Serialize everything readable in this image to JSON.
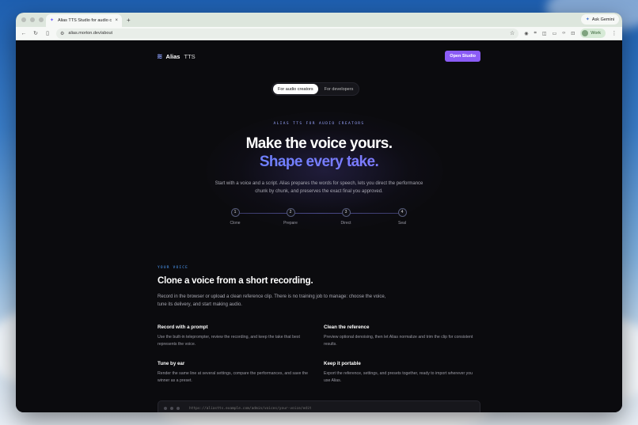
{
  "browser": {
    "tab_title": "Alias TTS Studio for audio cre",
    "close_glyph": "×",
    "new_tab_glyph": "+",
    "ask_label": "Ask Gemini",
    "url": "alias.morton.dev/about",
    "profile_label": "Work"
  },
  "site": {
    "brand": "Alias",
    "brand_suffix": "TTS",
    "cta_label": "Open Studio",
    "cta_color": "#8b5cf6"
  },
  "segments": [
    {
      "label": "For audio creators",
      "active": true
    },
    {
      "label": "For developers",
      "active": false
    }
  ],
  "hero": {
    "eyebrow": "ALIAS TTS FOR AUDIO CREATORS",
    "line1": "Make the voice yours.",
    "line2": "Shape every take.",
    "lede": "Start with a voice and a script. Alias prepares the words for speech, lets you direct the performance chunk by chunk, and preserves the exact final you approved."
  },
  "steps": [
    {
      "num": "1",
      "label": "Clone"
    },
    {
      "num": "2",
      "label": "Prepare"
    },
    {
      "num": "3",
      "label": "Direct"
    },
    {
      "num": "4",
      "label": "Seal"
    }
  ],
  "voice_section": {
    "eyebrow": "YOUR VOICE",
    "title": "Clone a voice from a short recording.",
    "desc": "Record in the browser or upload a clean reference clip. There is no training job to manage: choose the voice, tune its delivery, and start making audio.",
    "features": [
      {
        "title": "Record with a prompt",
        "desc": "Use the built-in teleprompter, review the recording, and keep the take that best represents the voice."
      },
      {
        "title": "Clean the reference",
        "desc": "Preview optional denoising, then let Alias normalize and trim the clip for consistent results."
      },
      {
        "title": "Tune by ear",
        "desc": "Render the same line at several settings, compare the performances, and save the winner as a preset."
      },
      {
        "title": "Keep it portable",
        "desc": "Export the reference, settings, and presets together, ready to import wherever you use Alias."
      }
    ]
  },
  "mock_browser": {
    "url": "https://aliastts.example.com/admin/voices/your-voice/edit"
  }
}
